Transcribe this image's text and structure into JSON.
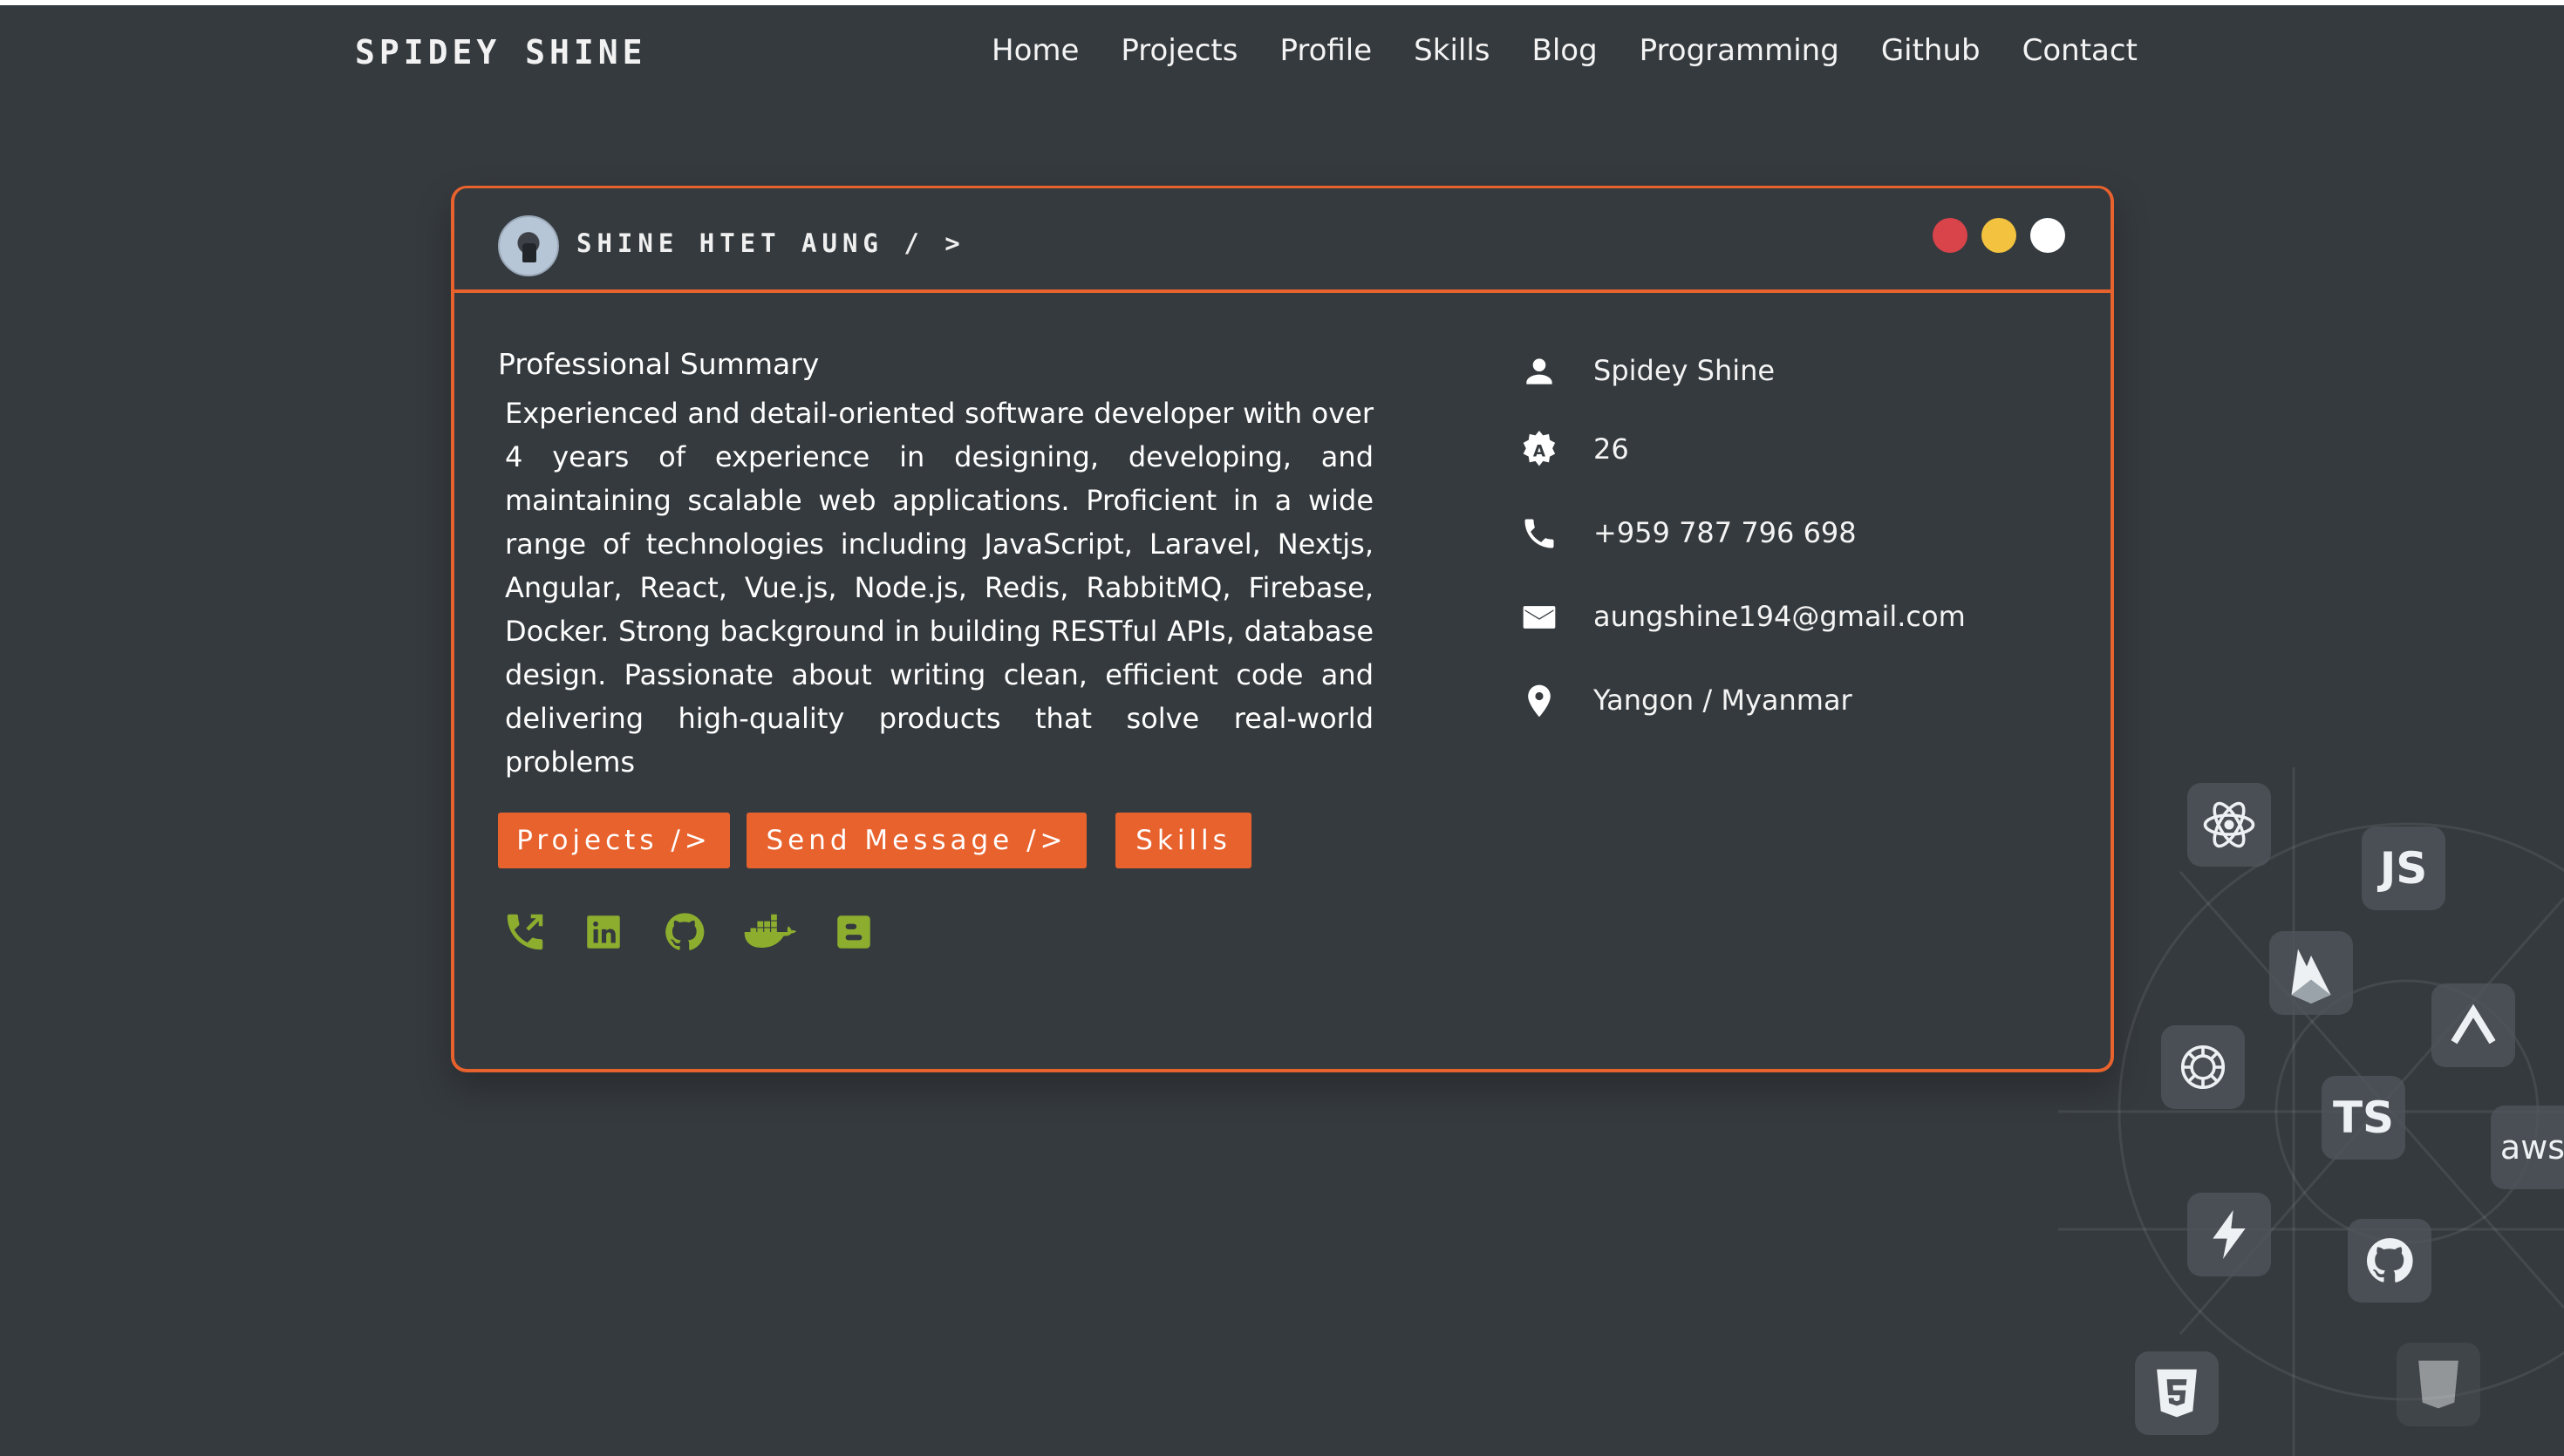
{
  "nav": {
    "brand": "SPIDEY SHINE",
    "links": [
      "Home",
      "Projects",
      "Profile",
      "Skills",
      "Blog",
      "Programming",
      "Github",
      "Contact"
    ]
  },
  "card": {
    "title": "SHINE HTET AUNG / >",
    "window_dots": [
      "#d9434a",
      "#f3c23e",
      "#ffffff"
    ],
    "summary_heading": "Professional Summary",
    "summary_text": "Experienced and detail-oriented software developer with over 4 years of experience in designing, developing, and maintaining scalable web applications. Proficient in a wide range of technologies including JavaScript, Laravel, Nextjs, Angular, React, Vue.js, Node.js, Redis, RabbitMQ, Firebase, Docker. Strong background in building RESTful APIs, database design. Passionate about writing clean, efficient code and delivering high-quality products that solve real-world problems",
    "buttons": {
      "projects": "Projects />",
      "send_message": "Send Message />",
      "skills": "Skills"
    },
    "socials": [
      "phone-forward-icon",
      "linkedin-icon",
      "github-icon",
      "docker-icon",
      "blogger-icon"
    ],
    "info": {
      "name": "Spidey Shine",
      "age": "26",
      "phone": "+959 787 796 698",
      "email": "aungshine194@gmail.com",
      "location": "Yangon / Myanmar"
    }
  },
  "tech_tiles": {
    "js": "JS",
    "ts": "TS",
    "aws": "aws",
    "icons": [
      "react-icon",
      "js-icon",
      "firebase-icon",
      "openai-icon",
      "arrow-up-icon",
      "ts-icon",
      "aws-icon",
      "vite-icon",
      "github-icon",
      "css3-icon",
      "html5-icon"
    ]
  },
  "colors": {
    "background": "#353a3e",
    "accent": "#e8622e",
    "social": "#8cad2e"
  }
}
